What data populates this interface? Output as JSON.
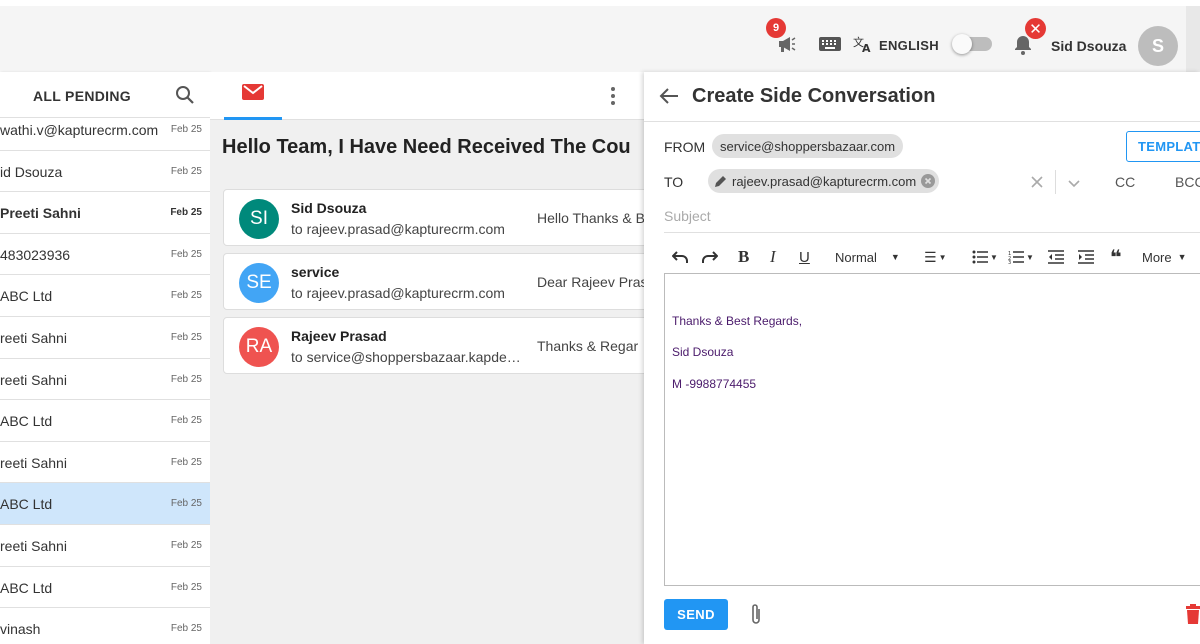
{
  "topbar": {
    "notification_count": "9",
    "language": "ENGLISH",
    "alert_badge": "✕",
    "user_name": "Sid Dsouza",
    "avatar_initial": "S"
  },
  "left_panel": {
    "title": "ALL PENDING",
    "items": [
      {
        "name": "wathi.v@kapturecrm.com",
        "date": "Feb 25",
        "bold": false,
        "selected": false
      },
      {
        "name": "id Dsouza",
        "date": "Feb 25",
        "bold": false,
        "selected": false
      },
      {
        "name": "Preeti Sahni",
        "date": "Feb 25",
        "bold": true,
        "selected": false
      },
      {
        "name": "483023936",
        "date": "Feb 25",
        "bold": false,
        "selected": false
      },
      {
        "name": "ABC Ltd",
        "date": "Feb 25",
        "bold": false,
        "selected": false
      },
      {
        "name": "reeti Sahni",
        "date": "Feb 25",
        "bold": false,
        "selected": false
      },
      {
        "name": "reeti Sahni",
        "date": "Feb 25",
        "bold": false,
        "selected": false
      },
      {
        "name": "ABC Ltd",
        "date": "Feb 25",
        "bold": false,
        "selected": false
      },
      {
        "name": "reeti Sahni",
        "date": "Feb 25",
        "bold": false,
        "selected": false
      },
      {
        "name": "ABC Ltd",
        "date": "Feb 25",
        "bold": false,
        "selected": true
      },
      {
        "name": "reeti Sahni",
        "date": "Feb 25",
        "bold": false,
        "selected": false
      },
      {
        "name": "ABC Ltd",
        "date": "Feb 25",
        "bold": false,
        "selected": false
      },
      {
        "name": "vinash",
        "date": "Feb 25",
        "bold": false,
        "selected": false
      }
    ]
  },
  "middle_panel": {
    "subject": "Hello Team, I Have Need Received The Cou",
    "threads": [
      {
        "initials": "SI",
        "color": "#00897b",
        "name": "Sid Dsouza",
        "to": "to rajeev.prasad@kapturecrm.com",
        "preview": "Hello Thanks & B"
      },
      {
        "initials": "SE",
        "color": "#42a5f5",
        "name": "service",
        "to": "to rajeev.prasad@kapturecrm.com",
        "preview": "Dear Rajeev Pras"
      },
      {
        "initials": "RA",
        "color": "#ef5350",
        "name": "Rajeev Prasad",
        "to": "to service@shoppersbazaar.kapdesk.com",
        "preview": "Thanks & Regar"
      }
    ]
  },
  "side_conversation": {
    "title": "Create Side Conversation",
    "from_label": "FROM",
    "from_value": "service@shoppersbazaar.com",
    "template_label": "TEMPLATES",
    "to_label": "TO",
    "to_value": "rajeev.prasad@kapturecrm.com",
    "cc_label": "CC",
    "bcc_label": "BCC",
    "subject_placeholder": "Subject",
    "toolbar": {
      "format_label": "Normal",
      "more_label": "More"
    },
    "body_lines": [
      "Thanks & Best Regards,",
      "Sid Dsouza",
      "M -9988774455"
    ],
    "send_label": "SEND"
  },
  "colors": {
    "accent": "#2196f3",
    "danger": "#e53935",
    "selected_row": "#cfe6fb"
  }
}
